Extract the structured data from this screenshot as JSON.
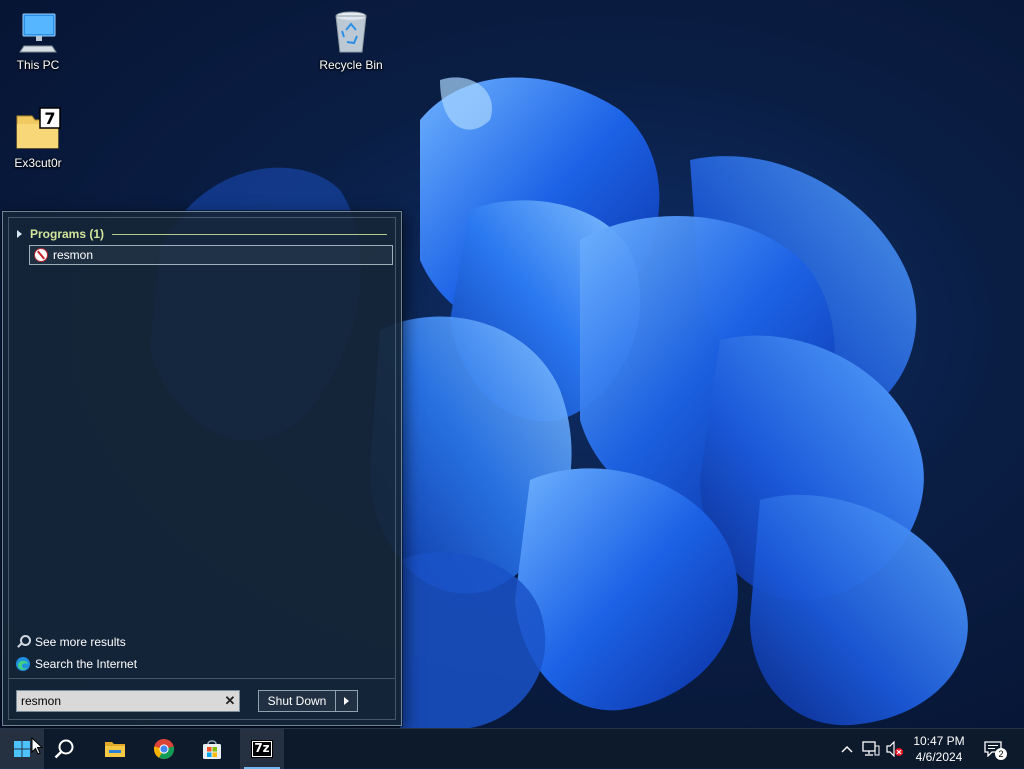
{
  "desktop": {
    "icons": [
      {
        "label": "This PC"
      },
      {
        "label": "Recycle Bin"
      },
      {
        "label": "Ex3cut0r"
      }
    ]
  },
  "start_menu": {
    "group_title": "Programs (1)",
    "results": [
      {
        "label": "resmon"
      }
    ],
    "see_more_label": "See more results",
    "search_internet_label": "Search the Internet",
    "search": {
      "value": "resmon"
    },
    "shutdown_label": "Shut Down"
  },
  "taskbar": {
    "apps": [
      {
        "icon": "windows-start-icon"
      },
      {
        "icon": "search-icon"
      },
      {
        "icon": "file-explorer-icon"
      },
      {
        "icon": "chrome-icon"
      },
      {
        "icon": "microsoft-store-icon"
      },
      {
        "icon": "7zip-icon",
        "label": "7z"
      }
    ],
    "clock": {
      "time": "10:47 PM",
      "date": "4/6/2024"
    },
    "notification_count": "2"
  },
  "colors": {
    "accent": "#76b9ed",
    "group_title": "#d3e59a"
  }
}
